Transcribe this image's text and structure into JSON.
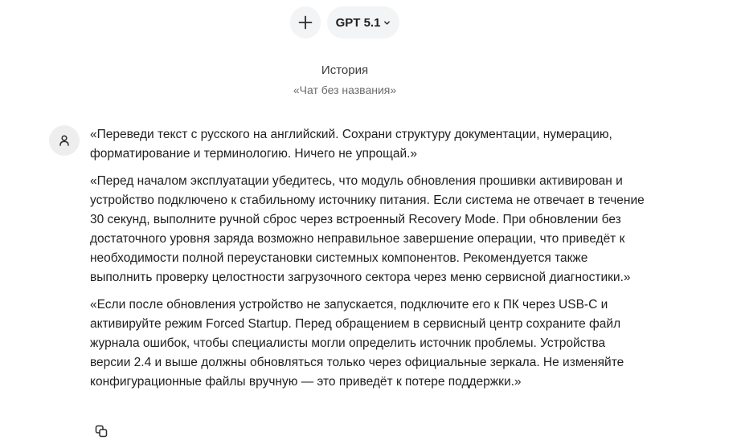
{
  "toolbar": {
    "new_chat_icon": "plus-icon",
    "model_label": "GPT 5.1",
    "model_chevron_icon": "chevron-down-icon"
  },
  "header": {
    "title": "История",
    "chat_name": "«Чат без названия»"
  },
  "message": {
    "avatar_icon": "user-icon",
    "paragraphs": [
      "«Переведи текст с русского на английский. Сохрани структуру документации, нумерацию, форматирование и терминологию. Ничего не упрощай.»",
      "«Перед началом эксплуатации убедитесь, что модуль обновления прошивки активирован и устройство подключено к стабильному источнику питания. Если система не отвечает в течение 30 секунд, выполните ручной сброс через встроенный Recovery Mode. При обновлении без достаточного уровня заряда возможно неправильное завершение операции, что приведёт к необходимости полной переустановки системных компонентов. Рекомендуется также выполнить проверку целостности загрузочного сектора через меню сервисной диагностики.»",
      "«Если после обновления устройство не запускается, подключите его к ПК через USB-C и активируйте режим Forced Startup. Перед обращением в сервисный центр сохраните файл журнала ошибок, чтобы специалисты могли определить источник проблемы. Устройства версии 2.4 и выше должны обновляться только через официальные зеркала. Не изменяйте конфигурационные файлы вручную — это приведёт к потере поддержки.»"
    ],
    "copy_icon": "copy-icon"
  }
}
